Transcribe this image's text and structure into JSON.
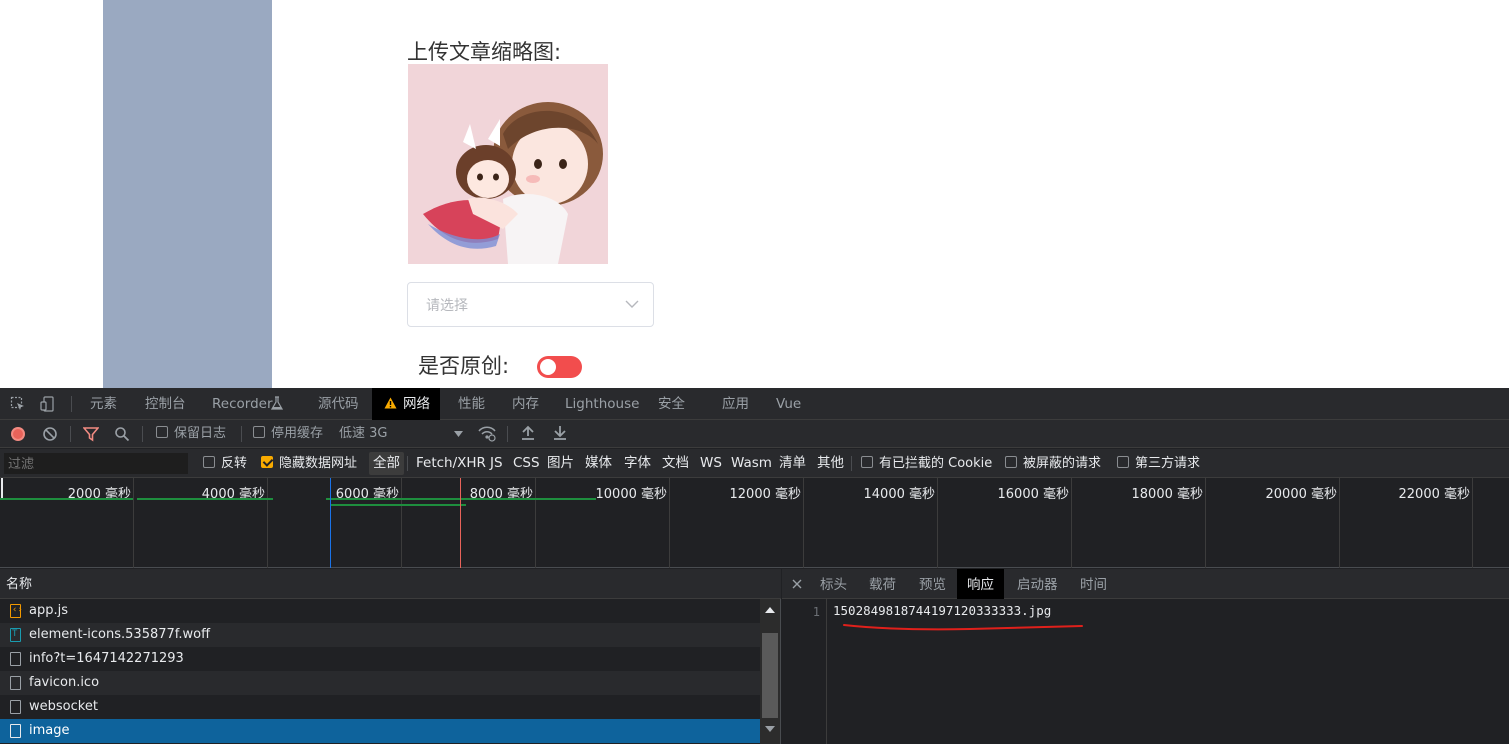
{
  "page": {
    "upload_label": "上传文章缩略图:",
    "select_placeholder": "请选择",
    "original_label": "是否原创:",
    "original_switch_on": true,
    "switch_color": "#f24d4d"
  },
  "devtools": {
    "tabs": [
      "元素",
      "控制台",
      "Recorder",
      "源代码",
      "网络",
      "性能",
      "内存",
      "Lighthouse",
      "安全",
      "应用",
      "Vue"
    ],
    "active_tab": "网络",
    "toolbar": {
      "preserve_log": "保留日志",
      "disable_cache": "停用缓存",
      "throttling": "低速 3G"
    },
    "filter": {
      "placeholder": "过滤",
      "invert": "反转",
      "hide_data_urls": "隐藏数据网址",
      "types": [
        "全部",
        "Fetch/XHR",
        "JS",
        "CSS",
        "图片",
        "媒体",
        "字体",
        "文档",
        "WS",
        "Wasm",
        "清单",
        "其他"
      ],
      "active_type": "全部",
      "blocked_cookies": "有已拦截的 Cookie",
      "blocked_requests": "被屏蔽的请求",
      "third_party": "第三方请求"
    },
    "timeline_ticks": [
      "2000 毫秒",
      "4000 毫秒",
      "6000 毫秒",
      "8000 毫秒",
      "10000 毫秒",
      "12000 毫秒",
      "14000 毫秒",
      "16000 毫秒",
      "18000 毫秒",
      "20000 毫秒",
      "22000 毫秒"
    ],
    "requests": {
      "column_name": "名称",
      "rows": [
        {
          "name": "app.js",
          "type": "js"
        },
        {
          "name": "element-icons.535877f.woff",
          "type": "font"
        },
        {
          "name": "info?t=1647142271293",
          "type": "doc"
        },
        {
          "name": "favicon.ico",
          "type": "doc"
        },
        {
          "name": "websocket",
          "type": "doc"
        },
        {
          "name": "image",
          "type": "doc"
        }
      ],
      "selected": "image"
    },
    "detail": {
      "tabs": [
        "标头",
        "载荷",
        "预览",
        "响应",
        "启动器",
        "时间"
      ],
      "active_tab": "响应",
      "line_number": "1",
      "response_text": "1502849818744197120333333.jpg",
      "annotation_color": "#e0201b"
    }
  }
}
